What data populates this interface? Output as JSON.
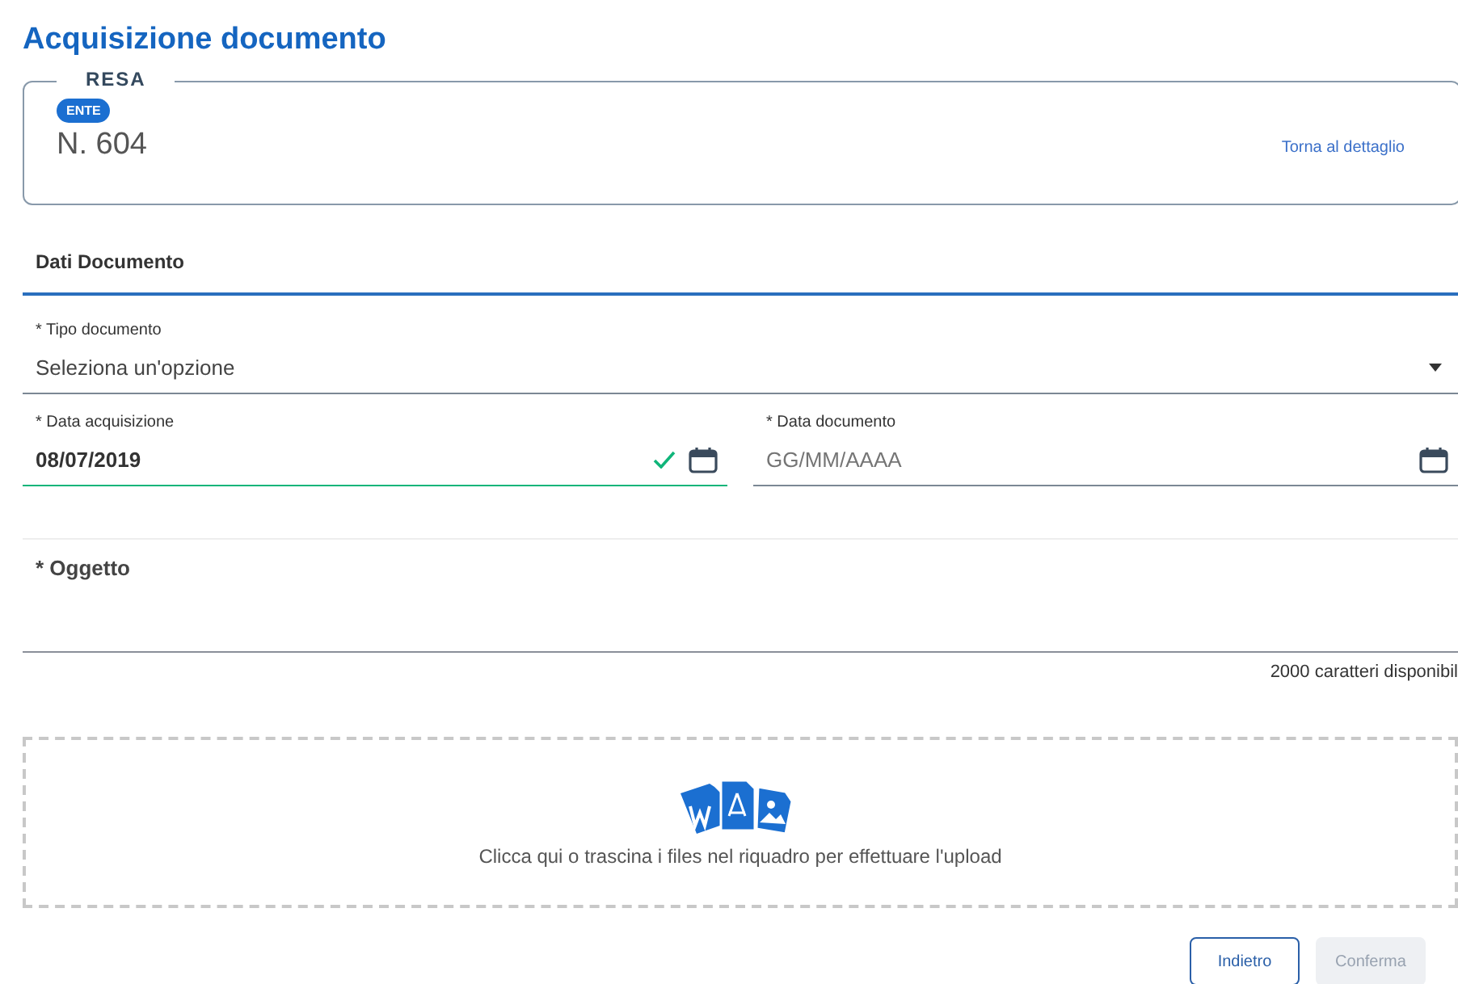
{
  "title": "Acquisizione documento",
  "record": {
    "legend": "RESA",
    "badge": "ENTE",
    "number": "N. 604",
    "link": "Torna al dettaglio"
  },
  "section": {
    "title": "Dati Documento"
  },
  "tipo": {
    "label": "* Tipo documento",
    "placeholder": "Seleziona un'opzione"
  },
  "dates": [
    {
      "label": "* Data acquisizione",
      "value": "08/07/2019",
      "valid": true
    },
    {
      "label": "* Data documento",
      "placeholder": "GG/MM/AAAA",
      "valid": false
    }
  ],
  "oggetto": {
    "label": "* Oggetto",
    "counter": "2000 caratteri disponibil"
  },
  "upload": {
    "text": "Clicca qui o trascina i files nel riquadro per effettuare l'upload"
  },
  "buttons": [
    {
      "label": "Indietro",
      "disabled": false
    },
    {
      "label": "Conferma",
      "disabled": true
    }
  ]
}
